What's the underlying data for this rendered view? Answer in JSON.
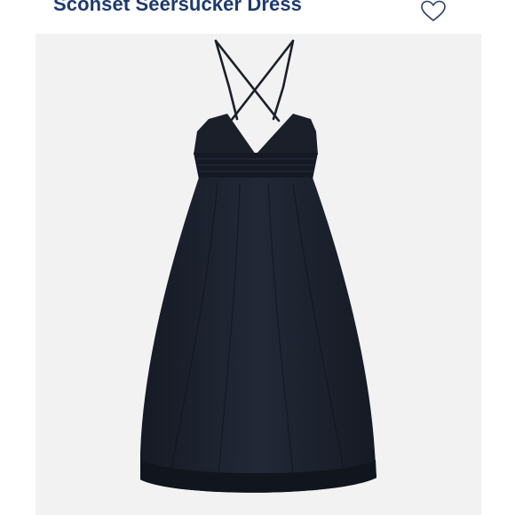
{
  "product": {
    "title": "Sconset Seersucker Dress",
    "favorite_icon": "heart-outline-icon",
    "image_description_icon": "dress-icon"
  },
  "colors": {
    "title": "#1d3a6d",
    "image_background": "#f2f2f2",
    "dress": "#1b1f2a",
    "heart_stroke": "#2a3d63"
  }
}
